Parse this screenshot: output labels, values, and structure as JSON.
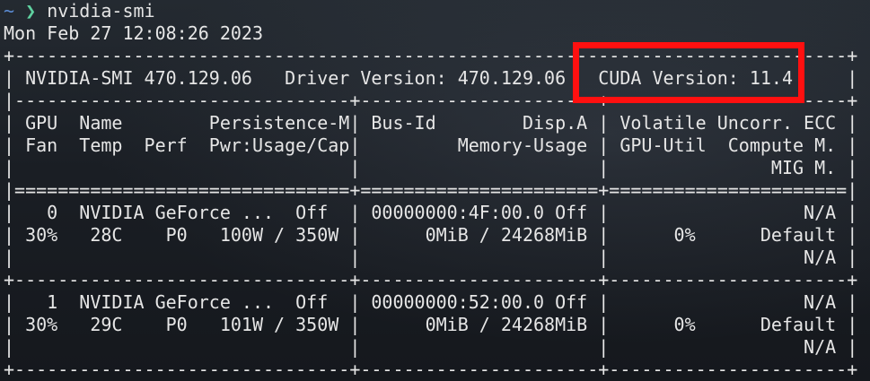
{
  "prompt": {
    "tilde": "~",
    "arrow": "❯",
    "command": "nvidia-smi"
  },
  "timestamp": "Mon Feb 27 12:08:26 2023",
  "output_lines": [
    "+-----------------------------------------------------------------------------+",
    "| NVIDIA-SMI 470.129.06   Driver Version: 470.129.06   CUDA Version: 11.4     |",
    "|-------------------------------+----------------------+----------------------+",
    "| GPU  Name        Persistence-M| Bus-Id        Disp.A | Volatile Uncorr. ECC |",
    "| Fan  Temp  Perf  Pwr:Usage/Cap|         Memory-Usage | GPU-Util  Compute M. |",
    "|                               |                      |               MIG M. |",
    "|===============================+======================+======================|",
    "|   0  NVIDIA GeForce ...  Off  | 00000000:4F:00.0 Off |                  N/A |",
    "| 30%   28C    P0   100W / 350W |      0MiB / 24268MiB |      0%      Default |",
    "|                               |                      |                  N/A |",
    "+-------------------------------+----------------------+----------------------+",
    "|   1  NVIDIA GeForce ...  Off  | 00000000:52:00.0 Off |                  N/A |",
    "| 30%   29C    P0   101W / 350W |      0MiB / 24268MiB |      0%      Default |",
    "|                               |                      |                  N/A |",
    "+-------------------------------+----------------------+----------------------+"
  ],
  "highlight_color": "#ff1010"
}
